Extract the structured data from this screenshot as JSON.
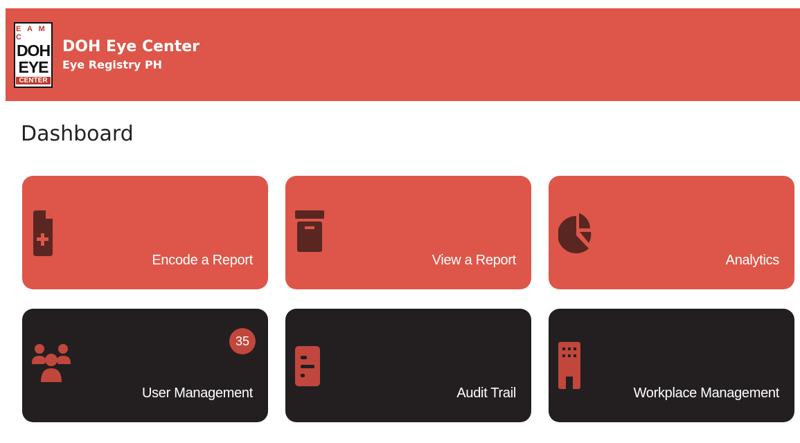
{
  "header": {
    "logo": {
      "top": "E A M C",
      "line1": "DOH",
      "line2": "EYE",
      "bottom": "CENTER"
    },
    "title": "DOH Eye Center",
    "subtitle": "Eye Registry PH"
  },
  "page": {
    "title": "Dashboard"
  },
  "tiles": [
    {
      "label": "Encode a Report",
      "icon": "file-plus-icon"
    },
    {
      "label": "View a Report",
      "icon": "archive-box-icon"
    },
    {
      "label": "Analytics",
      "icon": "pie-chart-icon"
    },
    {
      "label": "User Management",
      "icon": "users-icon",
      "badge": "35"
    },
    {
      "label": "Audit Trail",
      "icon": "audit-list-icon"
    },
    {
      "label": "Workplace Management",
      "icon": "building-icon"
    }
  ],
  "colors": {
    "primary": "#DD5649",
    "dark": "#231F20",
    "icon_on_red": "#5A2621",
    "icon_on_dark": "#C1473D"
  }
}
